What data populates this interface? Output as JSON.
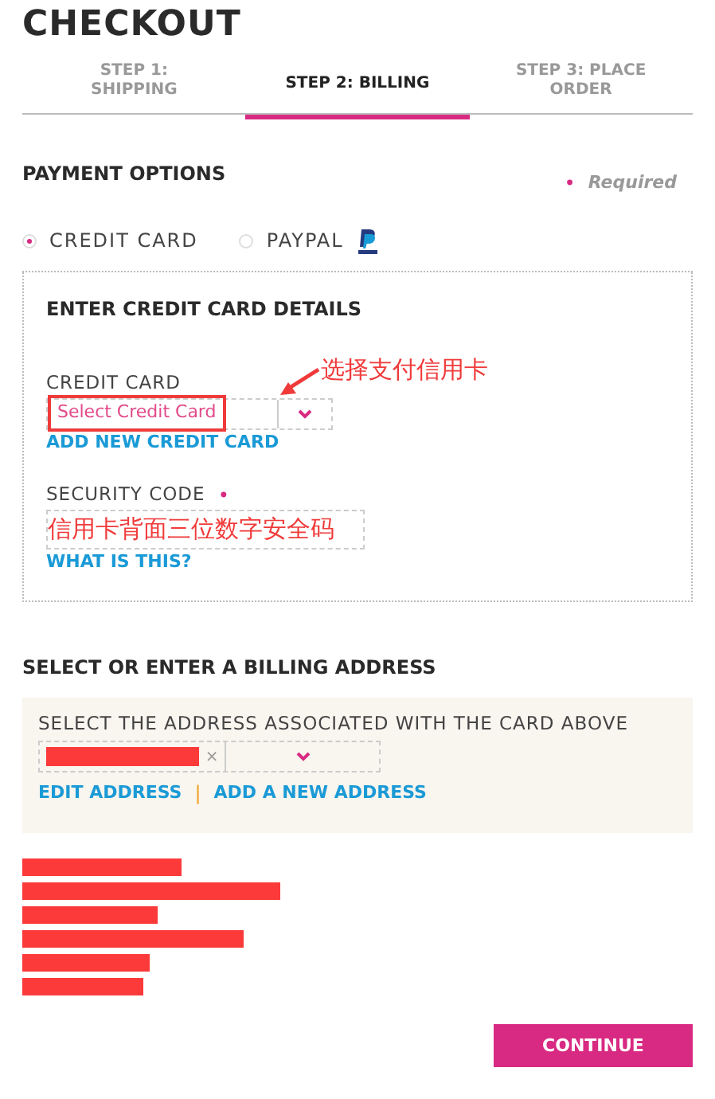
{
  "title": "CHECKOUT",
  "steps": [
    {
      "label": "STEP 1: SHIPPING",
      "selected": false
    },
    {
      "label": "STEP 2: BILLING",
      "selected": true
    },
    {
      "label": "STEP 3: PLACE ORDER",
      "selected": false
    }
  ],
  "payment": {
    "heading": "PAYMENT OPTIONS",
    "required_mark": "•",
    "required_label": "Required",
    "options": [
      {
        "label": "CREDIT CARD",
        "selected": true,
        "kind": "card"
      },
      {
        "label": "PAYPAL",
        "selected": false,
        "kind": "paypal"
      }
    ]
  },
  "card_details": {
    "heading": "ENTER CREDIT CARD DETAILS",
    "card_label": "CREDIT CARD",
    "card_placeholder": "Select Credit Card",
    "add_link": "ADD NEW CREDIT CARD",
    "security_label": "SECURITY CODE",
    "security_mark": "•",
    "security_link": "WHAT IS THIS?",
    "annotations": [
      {
        "kind": "card",
        "text": "选择支付信用卡"
      },
      {
        "kind": "security",
        "text": "信用卡背面三位数字安全码"
      }
    ]
  },
  "billing": {
    "heading": "SELECT OR ENTER A BILLING ADDRESS",
    "label": "SELECT THE ADDRESS ASSOCIATED WITH THE CARD ABOVE",
    "clear": "×",
    "links": [
      "EDIT ADDRESS",
      "ADD A NEW ADDRESS"
    ],
    "separator": "|"
  },
  "continue_button": "CONTINUE"
}
